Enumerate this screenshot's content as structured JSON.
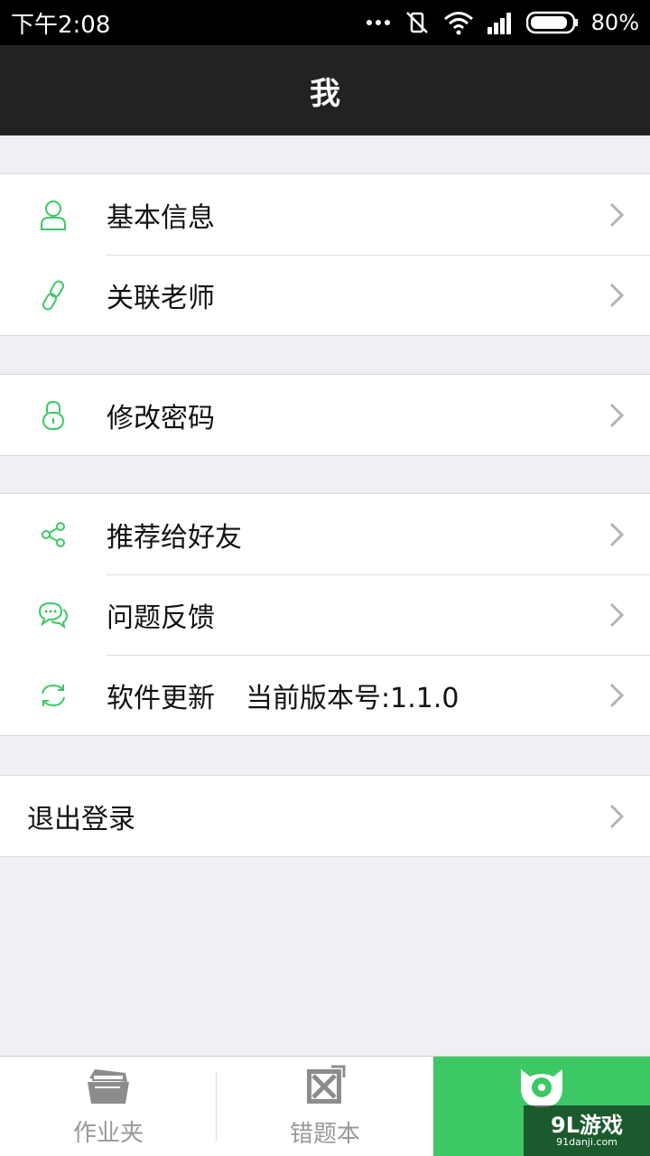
{
  "status": {
    "time": "下午2:08",
    "battery": "80%"
  },
  "title": "我",
  "groups": [
    {
      "items": [
        {
          "label": "基本信息",
          "icon": "user-icon"
        },
        {
          "label": "关联老师",
          "icon": "link-icon"
        }
      ]
    },
    {
      "items": [
        {
          "label": "修改密码",
          "icon": "lock-icon"
        }
      ]
    },
    {
      "items": [
        {
          "label": "推荐给好友",
          "icon": "share-icon"
        },
        {
          "label": "问题反馈",
          "icon": "chat-icon"
        },
        {
          "label": "软件更新",
          "extra": "当前版本号:1.1.0",
          "icon": "refresh-icon"
        }
      ]
    },
    {
      "items": [
        {
          "label": "退出登录"
        }
      ]
    }
  ],
  "tabs": [
    {
      "label": "作业夹",
      "icon": "folder-icon"
    },
    {
      "label": "错题本",
      "icon": "wrong-book-icon"
    },
    {
      "label": "",
      "icon": "monster-icon",
      "active": true
    }
  ],
  "watermark": {
    "main": "9L游戏",
    "sub": "91danji.com"
  },
  "colors": {
    "accent": "#3cc865",
    "header": "#222222",
    "background": "#efeff4"
  }
}
